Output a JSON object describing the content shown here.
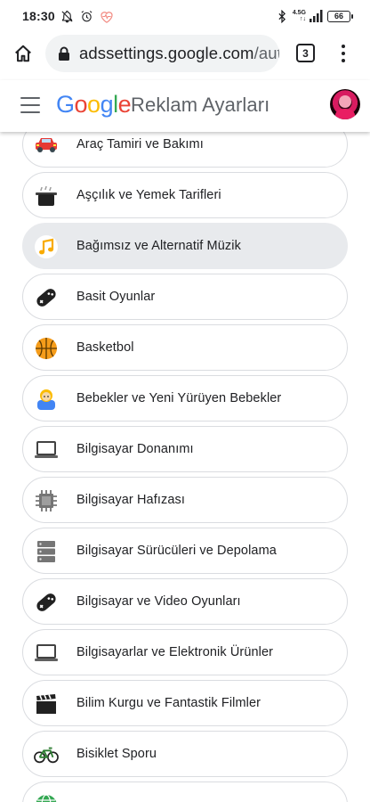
{
  "status_bar": {
    "time": "18:30",
    "network_label_top": "4.5G",
    "network_label_bottom": "↑↓",
    "battery": "66"
  },
  "browser": {
    "url_domain": "adssettings.google.com",
    "url_path": "/auth",
    "tab_count": "3"
  },
  "header": {
    "logo_letters": [
      "G",
      "o",
      "o",
      "g",
      "l",
      "e"
    ],
    "title": "Reklam Ayarları"
  },
  "categories": [
    {
      "label": "Araç Tamiri ve Bakımı",
      "icon": "car-icon"
    },
    {
      "label": "Aşçılık ve Yemek Tarifleri",
      "icon": "cooking-pot-icon"
    },
    {
      "label": "Bağımsız ve Alternatif Müzik",
      "icon": "music-note-icon"
    },
    {
      "label": "Basit Oyunlar",
      "icon": "gamepad-icon"
    },
    {
      "label": "Basketbol",
      "icon": "basketball-icon"
    },
    {
      "label": "Bebekler ve Yeni Yürüyen Bebekler",
      "icon": "baby-icon"
    },
    {
      "label": "Bilgisayar Donanımı",
      "icon": "laptop-icon"
    },
    {
      "label": "Bilgisayar Hafızası",
      "icon": "memory-chip-icon"
    },
    {
      "label": "Bilgisayar Sürücüleri ve Depolama",
      "icon": "storage-drive-icon"
    },
    {
      "label": "Bilgisayar ve Video Oyunları",
      "icon": "gamepad-icon"
    },
    {
      "label": "Bilgisayarlar ve Elektronik Ürünler",
      "icon": "laptop-icon"
    },
    {
      "label": "Bilim Kurgu ve Fantastik Filmler",
      "icon": "clapperboard-icon"
    },
    {
      "label": "Bisiklet Sporu",
      "icon": "bicycle-icon"
    },
    {
      "label": "",
      "icon": "globe-icon"
    }
  ],
  "selected_index": 2,
  "colors": {
    "google_blue": "#4285f4",
    "google_red": "#ea4335",
    "google_yellow": "#fbbc05",
    "google_green": "#34a853",
    "selected_row": "#e8eaed",
    "row_border": "#dadce0"
  }
}
